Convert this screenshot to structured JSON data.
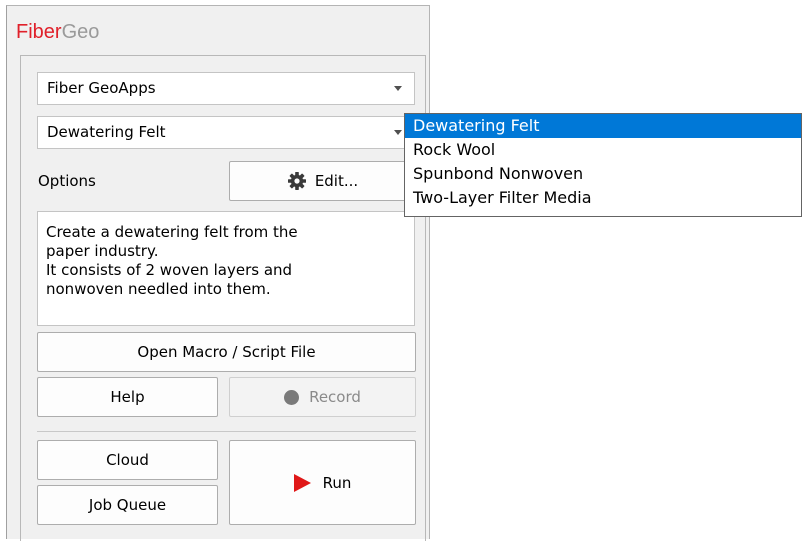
{
  "app": {
    "title_part1": "Fiber",
    "title_part2": "Geo"
  },
  "apps_combo": {
    "value": "Fiber GeoApps"
  },
  "type_combo": {
    "value": "Dewatering Felt"
  },
  "options": {
    "label": "Options",
    "edit_label": "Edit..."
  },
  "description": {
    "lines": [
      "Create a dewatering felt from the",
      "paper industry.",
      "It consists of 2 woven layers and",
      "nonwoven needled into them."
    ]
  },
  "buttons": {
    "open_macro": "Open Macro / Script File",
    "help": "Help",
    "record": "Record",
    "cloud": "Cloud",
    "job_queue": "Job Queue",
    "run": "Run"
  },
  "dropdown": {
    "selected_index": 0,
    "items": [
      "Dewatering Felt",
      "Rock Wool",
      "Spunbond Nonwoven",
      "Two-Layer Filter Media"
    ]
  },
  "icons": {
    "gear": "gear-icon",
    "record": "record-dot-icon",
    "run": "play-icon",
    "combo_arrow": "chevron-down-icon"
  },
  "colors": {
    "brand_red": "#e0202a",
    "brand_gray": "#9a9a9a",
    "selection": "#0078d7",
    "run_red": "#e01818"
  }
}
